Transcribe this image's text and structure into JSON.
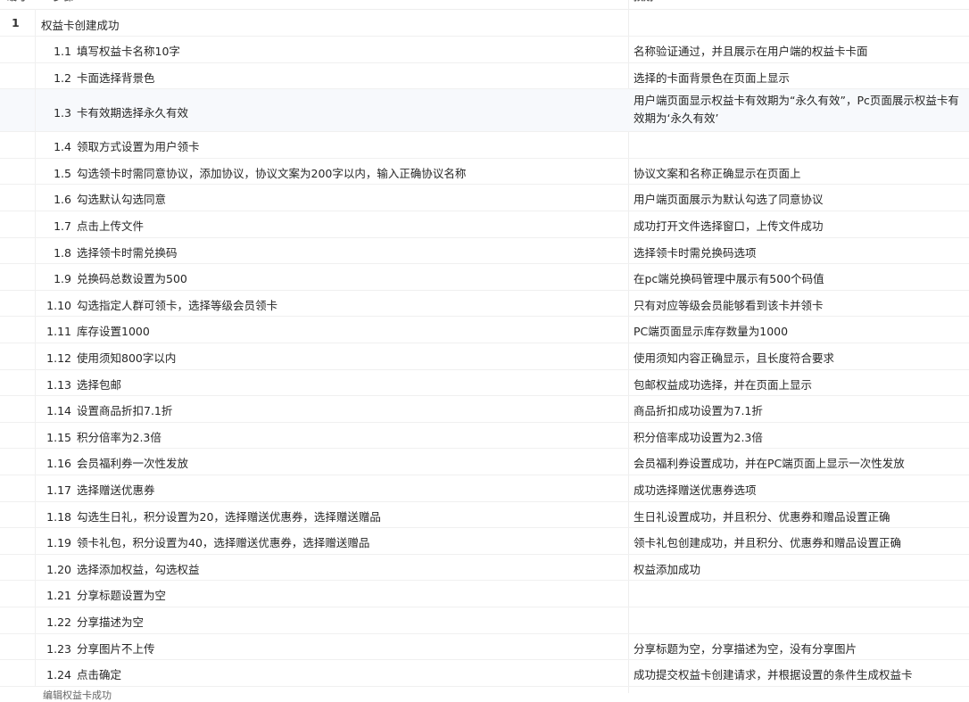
{
  "header": {
    "col_no": "编号",
    "col_step": "步骤",
    "col_result": "预期"
  },
  "group": {
    "no": "1",
    "title": "权益卡创建成功"
  },
  "rows": [
    {
      "num": "1.1",
      "step": "填写权益卡名称10字",
      "result": "名称验证通过，并且展示在用户端的权益卡卡面"
    },
    {
      "num": "1.2",
      "step": "卡面选择背景色",
      "result": "选择的卡面背景色在页面上显示"
    },
    {
      "num": "1.3",
      "step": "卡有效期选择永久有效",
      "result": "用户端页面显示权益卡有效期为“永久有效”，Pc页面展示权益卡有效期为‘永久有效’"
    },
    {
      "num": "1.4",
      "step": "领取方式设置为用户领卡",
      "result": ""
    },
    {
      "num": "1.5",
      "step": "勾选领卡时需同意协议，添加协议，协议文案为200字以内，输入正确协议名称",
      "result": "协议文案和名称正确显示在页面上"
    },
    {
      "num": "1.6",
      "step": "勾选默认勾选同意",
      "result": "用户端页面展示为默认勾选了同意协议"
    },
    {
      "num": "1.7",
      "step": "点击上传文件",
      "result": "成功打开文件选择窗口，上传文件成功"
    },
    {
      "num": "1.8",
      "step": "选择领卡时需兑换码",
      "result": "选择领卡时需兑换码选项"
    },
    {
      "num": "1.9",
      "step": "兑换码总数设置为500",
      "result": "在pc端兑换码管理中展示有500个码值"
    },
    {
      "num": "1.10",
      "step": "勾选指定人群可领卡，选择等级会员领卡",
      "result": "只有对应等级会员能够看到该卡并领卡"
    },
    {
      "num": "1.11",
      "step": "库存设置1000",
      "result": "PC端页面显示库存数量为1000"
    },
    {
      "num": "1.12",
      "step": "使用须知800字以内",
      "result": "使用须知内容正确显示，且长度符合要求"
    },
    {
      "num": "1.13",
      "step": "选择包邮",
      "result": "包邮权益成功选择，并在页面上显示"
    },
    {
      "num": "1.14",
      "step": "设置商品折扣7.1折",
      "result": "商品折扣成功设置为7.1折"
    },
    {
      "num": "1.15",
      "step": "积分倍率为2.3倍",
      "result": "积分倍率成功设置为2.3倍"
    },
    {
      "num": "1.16",
      "step": "会员福利券一次性发放",
      "result": "会员福利券设置成功，并在PC端页面上显示一次性发放"
    },
    {
      "num": "1.17",
      "step": "选择赠送优惠券",
      "result": "成功选择赠送优惠券选项"
    },
    {
      "num": "1.18",
      "step": "勾选生日礼，积分设置为20，选择赠送优惠券，选择赠送赠品",
      "result": "生日礼设置成功，并且积分、优惠券和赠品设置正确"
    },
    {
      "num": "1.19",
      "step": "领卡礼包，积分设置为40，选择赠送优惠券，选择赠送赠品",
      "result": "领卡礼包创建成功，并且积分、优惠券和赠品设置正确"
    },
    {
      "num": "1.20",
      "step": "选择添加权益，勾选权益",
      "result": "权益添加成功"
    },
    {
      "num": "1.21",
      "step": "分享标题设置为空",
      "result": ""
    },
    {
      "num": "1.22",
      "step": "分享描述为空",
      "result": ""
    },
    {
      "num": "1.23",
      "step": "分享图片不上传",
      "result": "分享标题为空，分享描述为空，没有分享图片"
    },
    {
      "num": "1.24",
      "step": "点击确定",
      "result": "成功提交权益卡创建请求，并根据设置的条件生成权益卡"
    }
  ],
  "footer_partial": "编辑权益卡成功"
}
